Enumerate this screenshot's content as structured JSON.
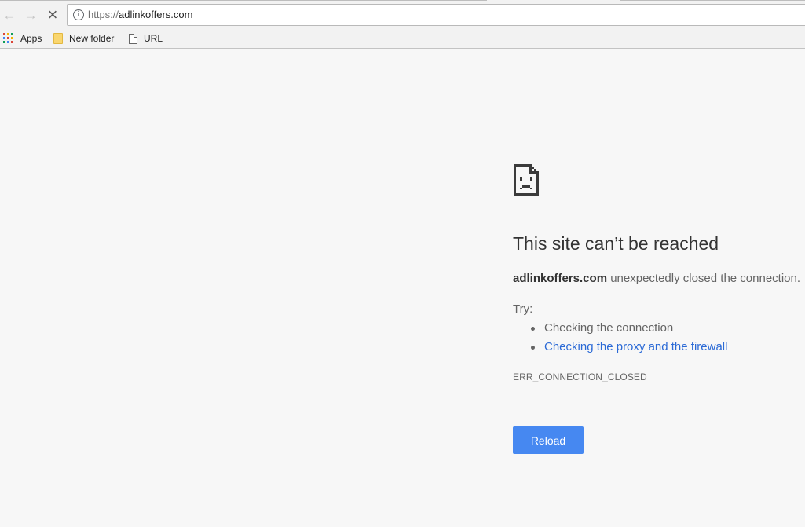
{
  "browser": {
    "url_scheme": "https://",
    "url_host": "adlinkoffers.com",
    "nav": {
      "back_icon": "back-arrow-icon",
      "forward_icon": "forward-arrow-icon",
      "stop_icon": "stop-icon"
    }
  },
  "bookmarks": {
    "items": [
      {
        "label": "Apps",
        "icon": "apps-grid-icon"
      },
      {
        "label": "New folder",
        "icon": "folder-icon"
      },
      {
        "label": "URL",
        "icon": "page-icon"
      }
    ]
  },
  "error_page": {
    "title": "This site can’t be reached",
    "host": "adlinkoffers.com",
    "description_suffix": " unexpectedly closed the connection.",
    "try_label": "Try:",
    "suggestions": [
      "Checking the connection",
      "Checking the proxy and the firewall"
    ],
    "error_code": "ERR_CONNECTION_CLOSED",
    "reload_label": "Reload",
    "icon": "sad-page-icon"
  },
  "colors": {
    "accent": "#4688f1",
    "link": "#2b6ad6",
    "page_background": "#f7f7f7"
  }
}
